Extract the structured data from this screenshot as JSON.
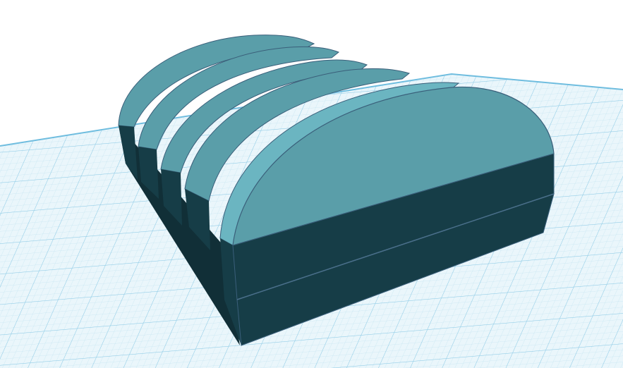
{
  "viewport": {
    "background": "#ffffff",
    "workplane": {
      "fill": "#eaf6fb",
      "minor_grid": "#c3e4f1",
      "major_grid": "#8ecbe6",
      "edge": "#6fbddf"
    }
  },
  "model": {
    "slice_count": 5,
    "colors": {
      "top_face": "#5a9ea9",
      "top_face_light": "#6bb5c1",
      "side_face": "#163d47",
      "side_face_dark": "#112f37",
      "outline": "#3a5f7a"
    }
  }
}
